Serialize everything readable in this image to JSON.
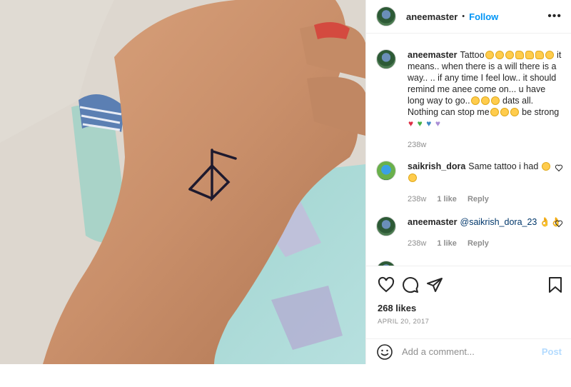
{
  "header": {
    "username": "aneemaster",
    "separator": "•",
    "follow_label": "Follow",
    "more_label": "•••"
  },
  "caption": {
    "username": "aneemaster",
    "text_1": "Tattoo",
    "text_2": " it means.. when there is a will there is a way.. .. if any time I feel low.. it should remind me anee come on... u have long way to go..",
    "text_3": " dats all. Nothing can stop me",
    "text_4": " be strong ",
    "time": "238w"
  },
  "comments": [
    {
      "username": "saikrish_dora",
      "text": "Same tattoo i had ",
      "time": "238w",
      "likes": "1 like",
      "reply": "Reply"
    },
    {
      "username": "aneemaster",
      "mention": "@saikrish_dora_23",
      "text": " 👌👌",
      "time": "238w",
      "likes": "1 like",
      "reply": "Reply"
    }
  ],
  "engagement": {
    "likes": "268 likes",
    "date": "APRIL 20, 2017"
  },
  "composer": {
    "placeholder": "Add a comment...",
    "post_label": "Post"
  },
  "colors": {
    "accent": "#0095f6",
    "post_disabled": "#b3dbff",
    "text": "#262626",
    "muted": "#8e8e8e",
    "border": "#efefef"
  },
  "icons": [
    "heart-icon",
    "comment-icon",
    "share-icon",
    "bookmark-icon",
    "smiley-icon",
    "more-options-icon"
  ]
}
